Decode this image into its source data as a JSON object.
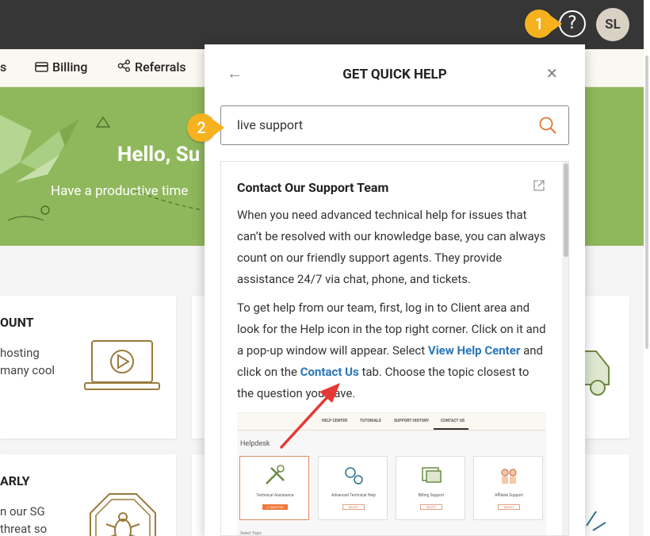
{
  "topbar": {
    "help_icon": "question-circle-icon",
    "help_glyph": "?",
    "avatar_initials": "SL"
  },
  "nav": {
    "items": [
      {
        "label": "s"
      },
      {
        "label": "Billing",
        "icon": "credit-card-icon"
      },
      {
        "label": "Referrals",
        "icon": "share-icon"
      }
    ]
  },
  "hero": {
    "title": "Hello, Su",
    "subtitle": "Have a productive time"
  },
  "cards": [
    {
      "title": "OUNT",
      "text_line1": "hosting",
      "text_line2": "many cool",
      "icon": "laptop-play-icon"
    },
    {
      "title": "ARLY",
      "text_line1": "n our SG",
      "text_line2": "threat so",
      "icon": "bug-shield-icon"
    }
  ],
  "callouts": {
    "step1": "1",
    "step2": "2"
  },
  "panel": {
    "title": "GET QUICK HELP",
    "back_glyph": "←",
    "close_glyph": "×",
    "search_value": "live support",
    "article": {
      "title": "Contact Our Support Team",
      "para1": "When you need advanced technical help for issues that can’t be resolved with our knowledge base, you can always count on our friendly support agents. They provide assistance 24/7 via chat, phone, and tickets.",
      "para2_a": "To get help from our team, first, log in to Client area and look for the Help icon in the top right corner. Click on it and a pop-up window will appear. Select ",
      "link1": "View Help Center",
      "para2_b": " and click on the ",
      "link2": "Contact Us",
      "para2_c": " tab. Choose the topic closest to the question you have."
    },
    "screenshot": {
      "tabs": [
        "HELP CENTER",
        "TUTORIALS",
        "SUPPORT HISTORY",
        "CONTACT US"
      ],
      "heading": "Helpdesk",
      "cards": [
        {
          "label": "Technical Assistance",
          "button": "✔ SELECTED"
        },
        {
          "label": "Advanced Technical Help",
          "button": "SELECT"
        },
        {
          "label": "Billing Support",
          "button": "SELECT"
        },
        {
          "label": "Affiliate Support",
          "button": "SELECT"
        }
      ],
      "footer": "Select Topic"
    }
  },
  "colors": {
    "topbar": "#363636",
    "hero": "#8fb85c",
    "badge": "#f5b21e",
    "link": "#2a77b8",
    "search_icon": "#e07b39",
    "arrow": "#e53935"
  }
}
